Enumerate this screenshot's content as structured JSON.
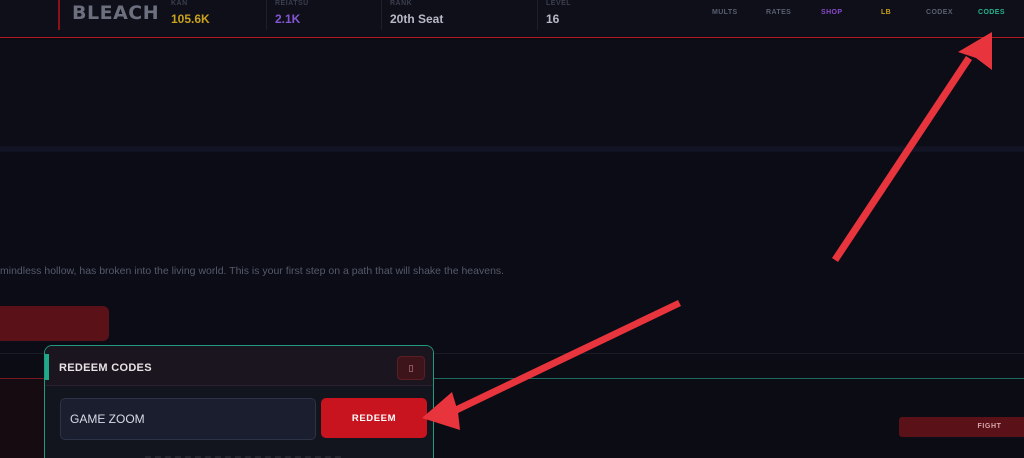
{
  "topbar": {
    "brand": "BLEACH",
    "stats": [
      {
        "label": "KAN",
        "value": "105.6K"
      },
      {
        "label": "REIATSU",
        "value": "2.1K"
      },
      {
        "label": "RANK",
        "value": "20th Seat"
      },
      {
        "label": "LEVEL",
        "value": "16"
      }
    ],
    "nav": [
      {
        "label": "MULTS",
        "color": "#5a5f72"
      },
      {
        "label": "RATES",
        "color": "#5a5f72"
      },
      {
        "label": "SHOP",
        "color": "#8b49c9"
      },
      {
        "label": "LB",
        "color": "#c9a11b"
      },
      {
        "label": "CODEX",
        "color": "#5a5f72"
      },
      {
        "label": "CODES",
        "color": "#23b38c"
      }
    ]
  },
  "main": {
    "story_text": "mindless hollow, has broken into the living world. This is your first step on a path that will shake the heavens.",
    "fight_label": "FIGHT"
  },
  "modal": {
    "title": "REDEEM CODES",
    "close_icon": "close-icon",
    "input_value": "GAME ZOOM",
    "redeem_label": "REDEEM"
  },
  "colors": {
    "accent_red": "#c8141f",
    "accent_teal": "#1f9b82",
    "annotation_arrow": "#e8343c"
  }
}
